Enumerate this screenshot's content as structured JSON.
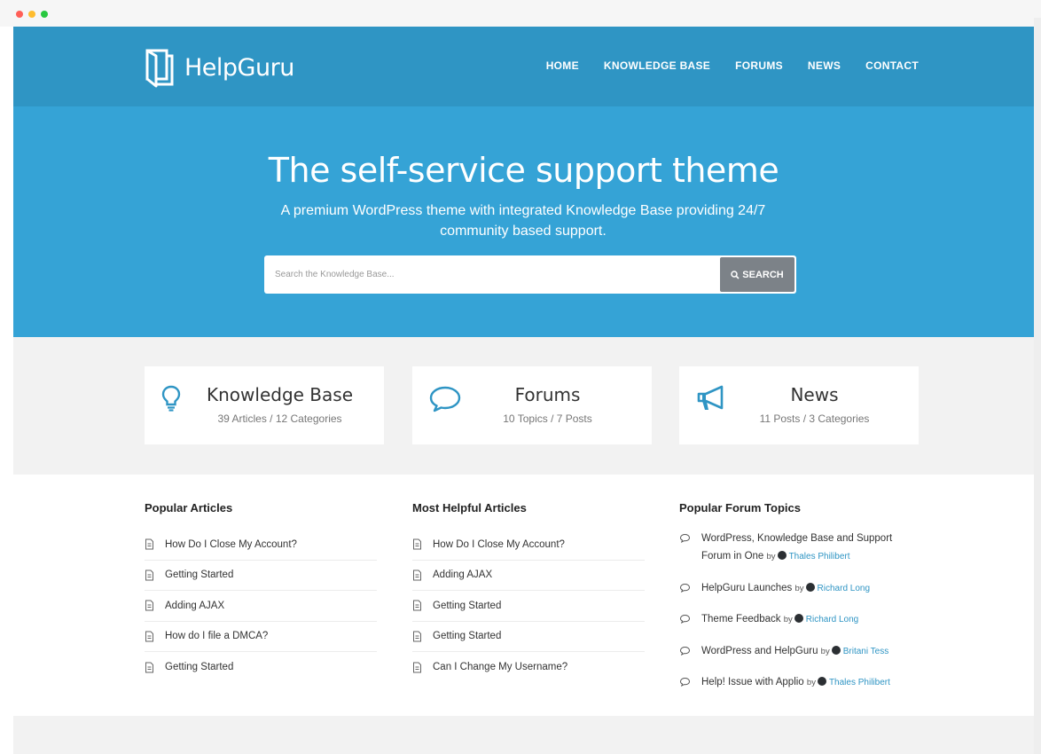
{
  "window": {
    "dot_colors": [
      "#ff5f57",
      "#febc2e",
      "#28c840"
    ]
  },
  "header": {
    "logo_text": "HelpGuru",
    "nav": [
      "HOME",
      "KNOWLEDGE BASE",
      "FORUMS",
      "NEWS",
      "CONTACT"
    ],
    "bg_color": "#2f95c4"
  },
  "hero": {
    "title": "The self-service support theme",
    "subtitle": "A premium WordPress theme with integrated Knowledge Base providing 24/7 community based support.",
    "search_placeholder": "Search the Knowledge Base...",
    "search_button": "SEARCH",
    "bg_color": "#35a3d6"
  },
  "boxes": [
    {
      "icon": "lightbulb-icon",
      "title": "Knowledge Base",
      "subtitle": "39 Articles / 12 Categories"
    },
    {
      "icon": "speech-bubble-icon",
      "title": "Forums",
      "subtitle": "10 Topics / 7 Posts"
    },
    {
      "icon": "megaphone-icon",
      "title": "News",
      "subtitle": "11 Posts / 3 Categories"
    }
  ],
  "popular_articles": {
    "heading": "Popular Articles",
    "items": [
      "How Do I Close My Account?",
      "Getting Started",
      "Adding AJAX",
      "How do I file a DMCA?",
      "Getting Started"
    ]
  },
  "helpful_articles": {
    "heading": "Most Helpful Articles",
    "items": [
      "How Do I Close My Account?",
      "Adding AJAX",
      "Getting Started",
      "Getting Started",
      "Can I Change My Username?"
    ]
  },
  "forum_topics": {
    "heading": "Popular Forum Topics",
    "by_label": "by",
    "items": [
      {
        "title": "WordPress, Knowledge Base and Support Forum in One",
        "author": "Thales Philibert"
      },
      {
        "title": "HelpGuru Launches",
        "author": "Richard Long"
      },
      {
        "title": "Theme Feedback",
        "author": "Richard Long"
      },
      {
        "title": "WordPress and HelpGuru",
        "author": "Britani Tess"
      },
      {
        "title": "Help! Issue with Applio",
        "author": "Thales Philibert"
      }
    ]
  },
  "accent_color": "#2f95c4"
}
